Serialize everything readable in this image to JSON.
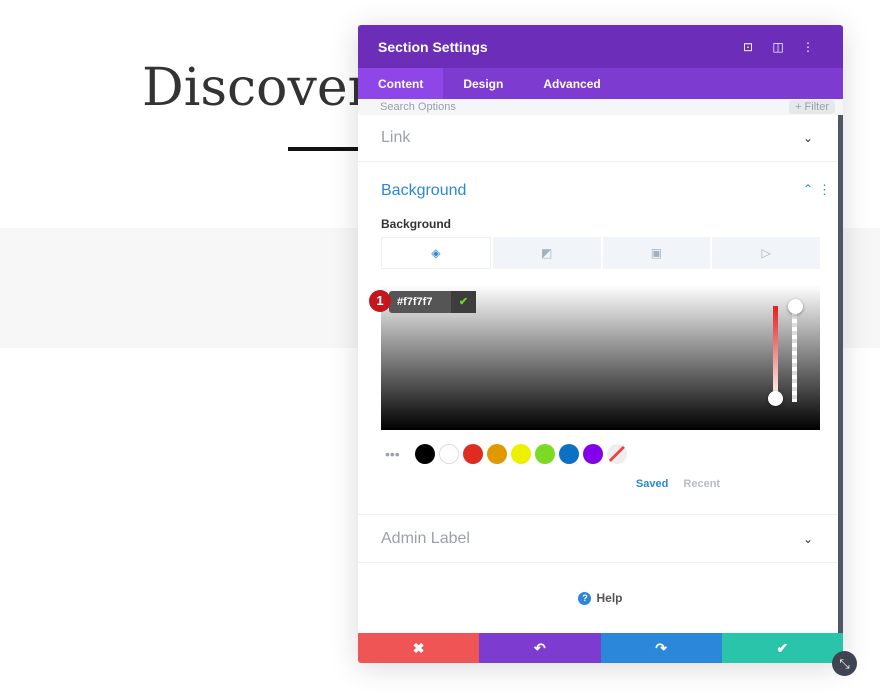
{
  "page": {
    "heading": "Discover"
  },
  "panel": {
    "title": "Section Settings",
    "icons": [
      "focus-icon",
      "sidebar-icon",
      "more-icon"
    ],
    "tabs": [
      {
        "label": "Content"
      },
      {
        "label": "Design"
      },
      {
        "label": "Advanced"
      }
    ],
    "search_placeholder": "Search Options",
    "filter_label": "+ Filter",
    "link_label": "Link",
    "background_title": "Background",
    "background_sub": "Background",
    "hex_value": "#f7f7f7",
    "step_badge": "1",
    "swatches": [
      "#000000",
      "#ffffff",
      "#e02b20",
      "#e09900",
      "#edf000",
      "#7cda24",
      "#0c71c3",
      "#8300e9"
    ],
    "saved_label": "Saved",
    "recent_label": "Recent",
    "admin_label": "Admin Label",
    "help_label": "Help"
  },
  "colors": {
    "header": "#6c2eb9",
    "cancel": "#ef5555",
    "undo": "#7e3bd0",
    "redo": "#2b87da",
    "save": "#29c4a9",
    "band": "#f7f7f7"
  }
}
